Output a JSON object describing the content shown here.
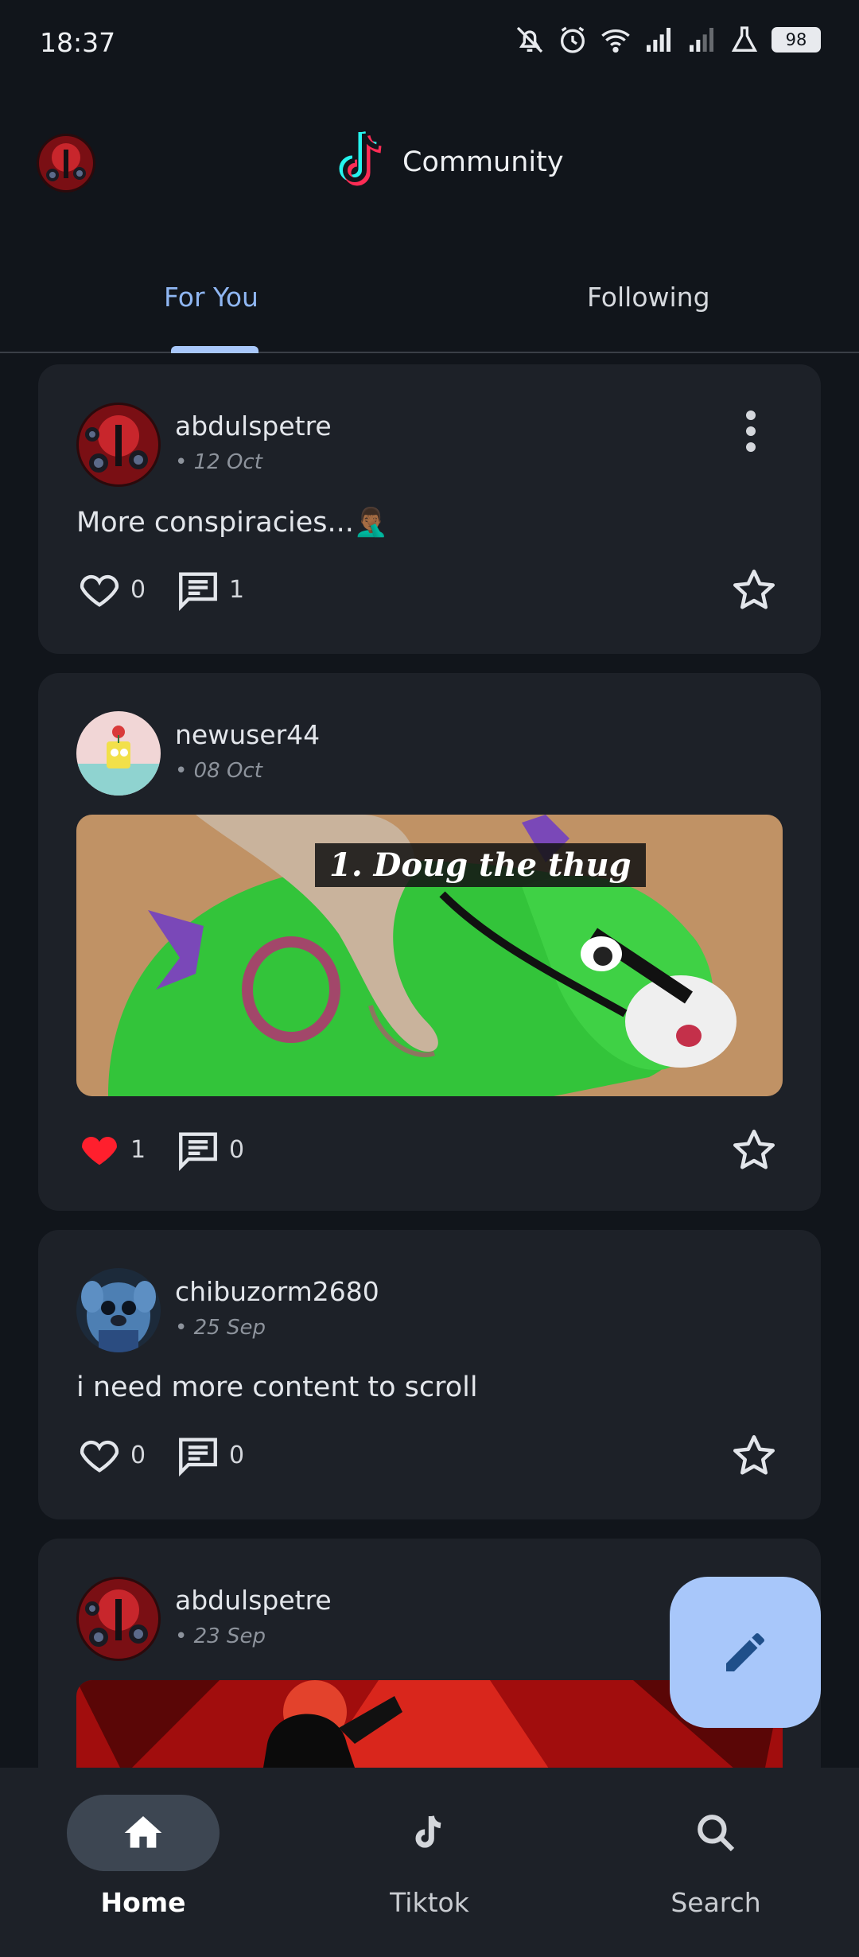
{
  "status_bar": {
    "time": "18:37",
    "battery": "98",
    "icons": [
      "bell-off-icon",
      "alarm-icon",
      "wifi-icon",
      "signal-icon",
      "signal-icon-2",
      "flask-icon",
      "battery-icon"
    ]
  },
  "header": {
    "title": "Community",
    "logo": "tiktok-logo"
  },
  "tabs": [
    {
      "label": "For You",
      "active": true
    },
    {
      "label": "Following",
      "active": false
    }
  ],
  "posts": [
    {
      "username": "abdulspetre",
      "date": "• 12 Oct",
      "text": "More conspiracies...🤦🏾‍♂️",
      "likes": "0",
      "comments": "1",
      "liked": false
    },
    {
      "username": "newuser44",
      "date": "• 08 Oct",
      "image_caption": "1. Doug the thug",
      "likes": "1",
      "comments": "0",
      "liked": true
    },
    {
      "username": "chibuzorm2680",
      "date": "• 25 Sep",
      "text": "i need more content to scroll",
      "likes": "0",
      "comments": "0",
      "liked": false
    },
    {
      "username": "abdulspetre",
      "date": "• 23 Sep"
    }
  ],
  "fab": {
    "icon": "pencil-icon"
  },
  "bottom_nav": [
    {
      "label": "Home",
      "icon": "home-icon",
      "active": true
    },
    {
      "label": "Tiktok",
      "icon": "tiktok-icon",
      "active": false
    },
    {
      "label": "Search",
      "icon": "search-icon",
      "active": false
    }
  ],
  "colors": {
    "background": "#11151b",
    "card": "#1d2128",
    "accent": "#a8c7fa",
    "like_active": "#ff1f2d"
  }
}
